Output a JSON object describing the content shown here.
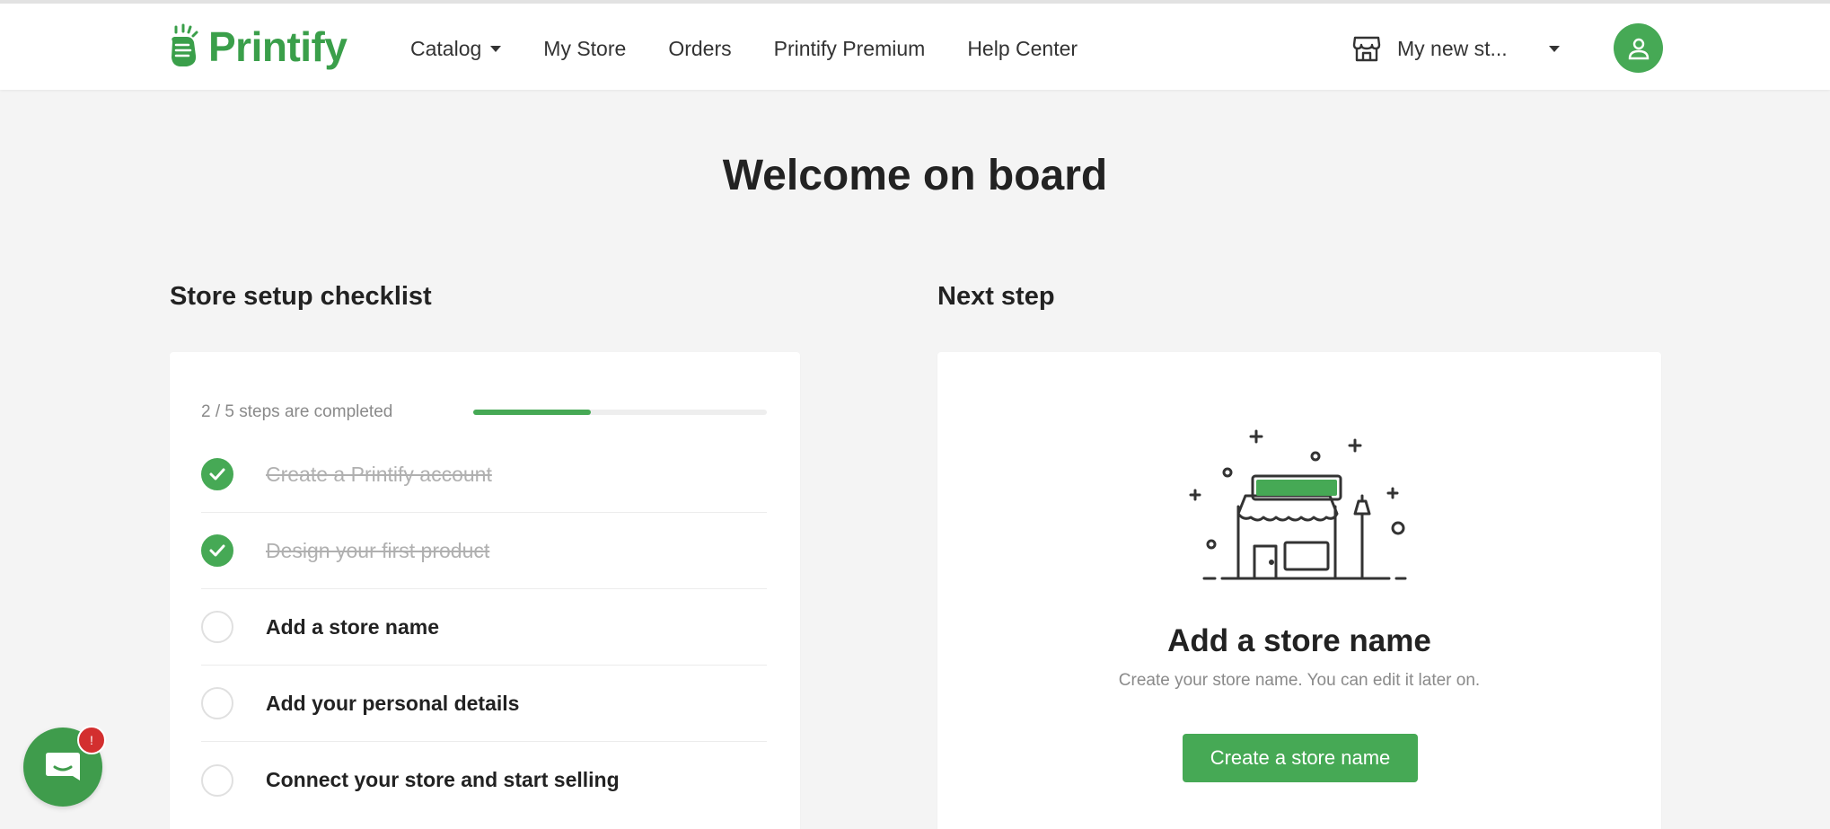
{
  "brand": {
    "name": "Printify",
    "accent": "#46a955",
    "logo_color": "#3a9f4a"
  },
  "nav": {
    "items": [
      {
        "label": "Catalog",
        "has_dropdown": true
      },
      {
        "label": "My Store"
      },
      {
        "label": "Orders"
      },
      {
        "label": "Printify Premium"
      },
      {
        "label": "Help Center"
      }
    ],
    "store_switcher": {
      "label": "My new st...",
      "icon": "store-icon"
    },
    "account_icon": "user-icon"
  },
  "page": {
    "heading": "Welcome on board"
  },
  "checklist": {
    "title": "Store setup checklist",
    "progress_text": "2 / 5 steps are completed",
    "progress_fraction": 0.4,
    "items": [
      {
        "label": "Create a Printify account",
        "done": true
      },
      {
        "label": "Design your first product",
        "done": true
      },
      {
        "label": "Add a store name",
        "done": false
      },
      {
        "label": "Add your personal details",
        "done": false
      },
      {
        "label": "Connect your store and start selling",
        "done": false
      }
    ]
  },
  "next_step": {
    "title": "Next step",
    "card_title": "Add a store name",
    "card_subtitle": "Create your store name. You can edit it later on.",
    "button_label": "Create a store name",
    "illustration": "storefront-illustration"
  },
  "chat": {
    "icon": "chat-icon",
    "badge": "!",
    "badge_color": "#d32f2f"
  }
}
